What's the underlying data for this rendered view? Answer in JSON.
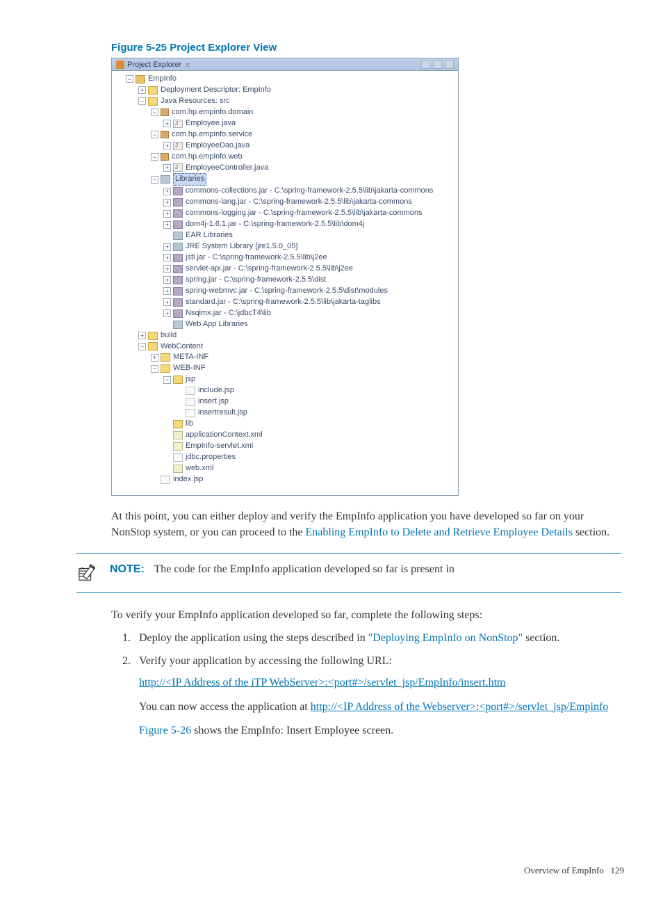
{
  "figure_title": "Figure 5-25 Project Explorer View",
  "explorer": {
    "header_title": "Project Explorer",
    "tree": {
      "root": "EmpInfo",
      "n1": "Deployment Descriptor: EmpInfo",
      "n2": "Java Resources: src",
      "n2a": "com.hp.empinfo.domain",
      "n2a1": "Employee.java",
      "n2b": "com.hp.empinfo.service",
      "n2b1": "EmployeeDao.java",
      "n2c": "com.hp.empinfo.web",
      "n2c1": "EmployeeController.java",
      "n2d": "Libraries",
      "lib1": "commons-collections.jar - C:\\spring-framework-2.5.5\\lib\\jakarta-commons",
      "lib2": "commons-lang.jar - C:\\spring-framework-2.5.5\\lib\\jakarta-commons",
      "lib3": "commons-logging.jar - C:\\spring-framework-2.5.5\\lib\\jakarta-commons",
      "lib4": "dom4j-1.6.1.jar - C:\\spring-framework-2.5.5\\lib\\dom4j",
      "lib5": "EAR Libraries",
      "lib6": "JRE System Library [jre1.5.0_05]",
      "lib7": "jstl.jar - C:\\spring-framework-2.5.5\\lib\\j2ee",
      "lib8": "servlet-api.jar - C:\\spring-framework-2.5.5\\lib\\j2ee",
      "lib9": "spring.jar - C:\\spring-framework-2.5.5\\dist",
      "lib10": "spring-webmvc.jar - C:\\spring-framework-2.5.5\\dist\\modules",
      "lib11": "standard.jar - C:\\spring-framework-2.5.5\\lib\\jakarta-taglibs",
      "lib12": "Nsqlmx.jar - C:\\jdbcT4\\lib",
      "lib13": "Web App Libraries",
      "n3": "build",
      "n4": "WebContent",
      "n4a": "META-INF",
      "n4b": "WEB-INF",
      "n4b1": "jsp",
      "jsp1": "include.jsp",
      "jsp2": "insert.jsp",
      "jsp3": "insertresult.jsp",
      "n4b2": "lib",
      "f1": "applicationContext.xml",
      "f2": "EmpInfo-servlet.xml",
      "f3": "jdbc.properties",
      "f4": "web.xml",
      "n4c": "index.jsp"
    }
  },
  "para1_a": "At this point, you can either deploy and verify the EmpInfo application you have developed so far on your NonStop system, or you can proceed to the ",
  "para1_link": "Enabling EmpInfo to Delete and Retrieve Employee Details",
  "para1_b": " section.",
  "note_label": "NOTE:",
  "note_text": "The code for the EmpInfo application developed so far is present in",
  "para2": "To verify your EmpInfo application developed so far, complete the following steps:",
  "step1_a": "Deploy the application using the steps described in ",
  "step1_link": "\"Deploying EmpInfo on NonStop\"",
  "step1_b": " section.",
  "step2_a": "Verify your application by accessing the following URL:",
  "step2_url1": "http://<IP Address of the iTP WebServer>:<port#>/servlet_jsp/EmpInfo/insert.htm",
  "step2_b": "You can now access the application at ",
  "step2_url2": "http://<IP Address of the Webserver>:<port#>/servlet_jsp/Empinfo",
  "step2_c_a": "",
  "step2_c_link": "Figure 5-26",
  "step2_c_b": " shows the EmpInfo: Insert Employee screen.",
  "footer_text": "Overview of EmpInfo",
  "footer_page": "129"
}
